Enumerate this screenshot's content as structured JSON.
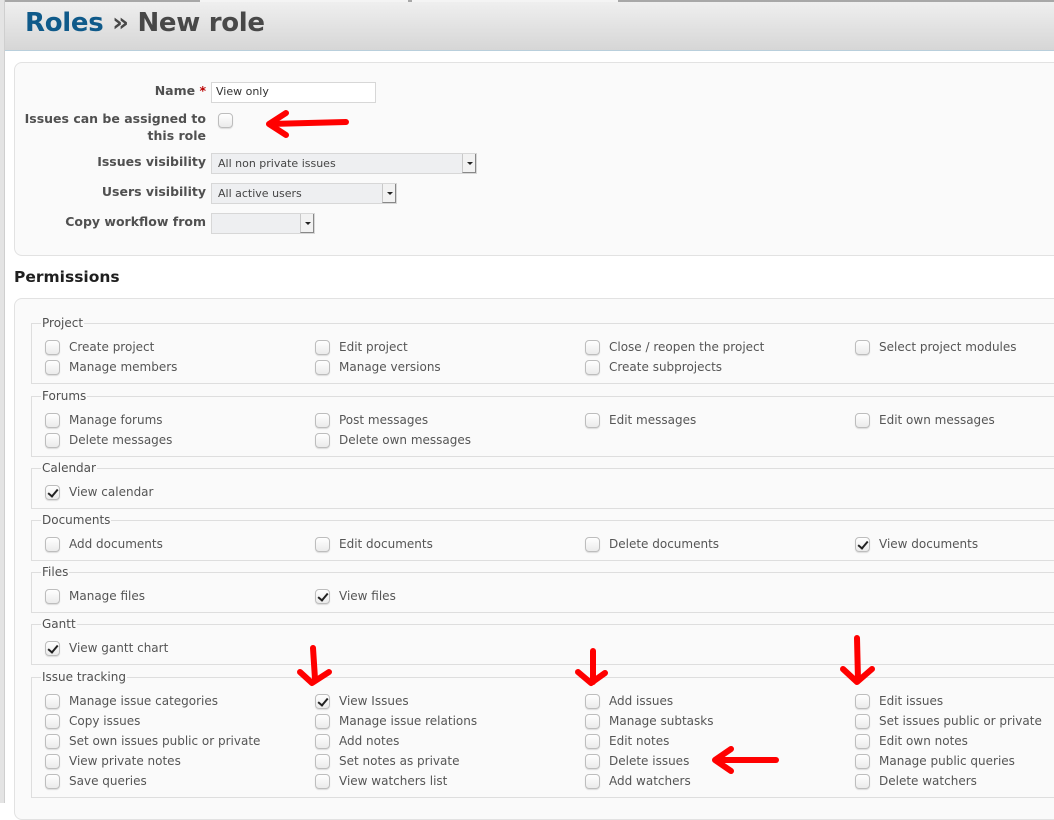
{
  "header": {
    "crumb": "Roles",
    "separator": "»",
    "title": "New role"
  },
  "form": {
    "name_label": "Name",
    "required_mark": "*",
    "name_value": "View only",
    "assignable_label_line1": "Issues can be assigned to",
    "assignable_label_line2": "this role",
    "assignable_checked": false,
    "issues_visibility_label": "Issues visibility",
    "issues_visibility_value": "All non private issues",
    "users_visibility_label": "Users visibility",
    "users_visibility_value": "All active users",
    "copy_workflow_label": "Copy workflow from",
    "copy_workflow_value": ""
  },
  "permissions": {
    "title": "Permissions",
    "groups": [
      {
        "name": "Project",
        "items": [
          {
            "label": "Create project",
            "checked": false
          },
          {
            "label": "Edit project",
            "checked": false
          },
          {
            "label": "Close / reopen the project",
            "checked": false
          },
          {
            "label": "Select project modules",
            "checked": false
          },
          {
            "label": "Manage members",
            "checked": false
          },
          {
            "label": "Manage versions",
            "checked": false
          },
          {
            "label": "Create subprojects",
            "checked": false
          }
        ]
      },
      {
        "name": "Forums",
        "items": [
          {
            "label": "Manage forums",
            "checked": false
          },
          {
            "label": "Post messages",
            "checked": false
          },
          {
            "label": "Edit messages",
            "checked": false
          },
          {
            "label": "Edit own messages",
            "checked": false
          },
          {
            "label": "Delete messages",
            "checked": false
          },
          {
            "label": "Delete own messages",
            "checked": false
          }
        ]
      },
      {
        "name": "Calendar",
        "items": [
          {
            "label": "View calendar",
            "checked": true
          }
        ]
      },
      {
        "name": "Documents",
        "items": [
          {
            "label": "Add documents",
            "checked": false
          },
          {
            "label": "Edit documents",
            "checked": false
          },
          {
            "label": "Delete documents",
            "checked": false
          },
          {
            "label": "View documents",
            "checked": true
          }
        ]
      },
      {
        "name": "Files",
        "items": [
          {
            "label": "Manage files",
            "checked": false
          },
          {
            "label": "View files",
            "checked": true
          }
        ]
      },
      {
        "name": "Gantt",
        "items": [
          {
            "label": "View gantt chart",
            "checked": true
          }
        ]
      },
      {
        "name": "Issue tracking",
        "items": [
          {
            "label": "Manage issue categories",
            "checked": false
          },
          {
            "label": "View Issues",
            "checked": true
          },
          {
            "label": "Add issues",
            "checked": false
          },
          {
            "label": "Edit issues",
            "checked": false
          },
          {
            "label": "Copy issues",
            "checked": false
          },
          {
            "label": "Manage issue relations",
            "checked": false
          },
          {
            "label": "Manage subtasks",
            "checked": false
          },
          {
            "label": "Set issues public or private",
            "checked": false
          },
          {
            "label": "Set own issues public or private",
            "checked": false
          },
          {
            "label": "Add notes",
            "checked": false
          },
          {
            "label": "Edit notes",
            "checked": false
          },
          {
            "label": "Edit own notes",
            "checked": false
          },
          {
            "label": "View private notes",
            "checked": false
          },
          {
            "label": "Set notes as private",
            "checked": false
          },
          {
            "label": "Delete issues",
            "checked": false
          },
          {
            "label": "Manage public queries",
            "checked": false
          },
          {
            "label": "Save queries",
            "checked": false
          },
          {
            "label": "View watchers list",
            "checked": false
          },
          {
            "label": "Add watchers",
            "checked": false
          },
          {
            "label": "Delete watchers",
            "checked": false
          }
        ]
      }
    ]
  },
  "annotations": {
    "color": "#ff0000"
  }
}
